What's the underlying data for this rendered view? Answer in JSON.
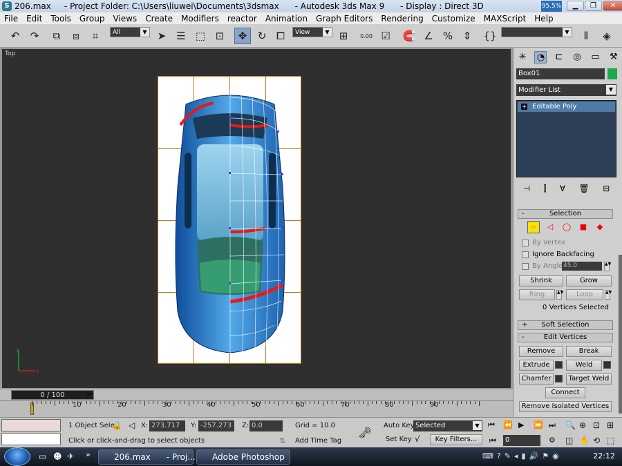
{
  "window": {
    "title": "206.max     - Project Folder: C:\\Users\\liuwei\\Documents\\3dsmax      - Autodesk 3ds Max 9      - Display : Direct 3D",
    "perf_readout": "95.5%",
    "btn_min": "▁",
    "btn_max": "❐",
    "btn_close": "✕"
  },
  "menu": [
    "File",
    "Edit",
    "Tools",
    "Group",
    "Views",
    "Create",
    "Modifiers",
    "reactor",
    "Animation",
    "Graph Editors",
    "Rendering",
    "Customize",
    "MAXScript",
    "Help"
  ],
  "toolbar": {
    "selection_filter": "All",
    "ref_coord": "View",
    "snap_value": "0.00",
    "named_selection": "",
    "icons": [
      "undo-icon",
      "redo-icon",
      "link-icon",
      "unlink-icon",
      "bind-space-warp-icon",
      "select-icon",
      "select-by-name-icon",
      "rect-region-icon",
      "window-crossing-icon",
      "move-icon",
      "rotate-icon",
      "scale-icon"
    ]
  },
  "viewport": {
    "label": "Top",
    "axis_x": "x",
    "axis_y": "y"
  },
  "timeslider": {
    "label": "0 / 100",
    "next": ">"
  },
  "trackbar": {
    "ticks": [
      "10",
      "20",
      "30",
      "40",
      "50",
      "60",
      "70",
      "80",
      "90"
    ]
  },
  "command_panel": {
    "object_name": "Box01",
    "object_color": "#1fa84a",
    "modifier_list": "Modifier List",
    "stack_items": [
      {
        "label": "Editable Poly"
      }
    ],
    "selection_rollout": {
      "title": "Selection",
      "by_vertex": "By Vertex",
      "ignore_backfacing": "Ignore Backfacing",
      "by_angle": "By Angle:",
      "angle_value": "45.0",
      "shrink": "Shrink",
      "grow": "Grow",
      "ring": "Ring",
      "loop": "Loop",
      "selected_count": "0 Vertices Selected"
    },
    "soft_selection": "Soft Selection",
    "edit_vertices": {
      "title": "Edit Vertices",
      "remove": "Remove",
      "break": "Break",
      "extrude": "Extrude",
      "weld": "Weld",
      "chamfer": "Chamfer",
      "target_weld": "Target Weld",
      "connect": "Connect",
      "remove_isolated": "Remove Isolated Vertices"
    }
  },
  "status": {
    "selection_info": "1 Object Sele",
    "x_label": "X:",
    "x_value": "273.717",
    "y_label": "Y:",
    "y_value": "-257.273",
    "z_label": "Z:",
    "z_value": "0.0",
    "grid": "Grid = 10.0",
    "prompt": "Click or click-and-drag to select objects",
    "add_time_tag": "Add Time Tag",
    "auto_key": "Auto Key",
    "set_key": "Set Key",
    "key_mode": "Selected",
    "key_filters": "Key Filters...",
    "frame": "0"
  },
  "taskbar": {
    "items": [
      {
        "label": "206.max      - Proj..."
      },
      {
        "label": "Adobe Photoshop"
      }
    ],
    "clock": "22:12"
  }
}
